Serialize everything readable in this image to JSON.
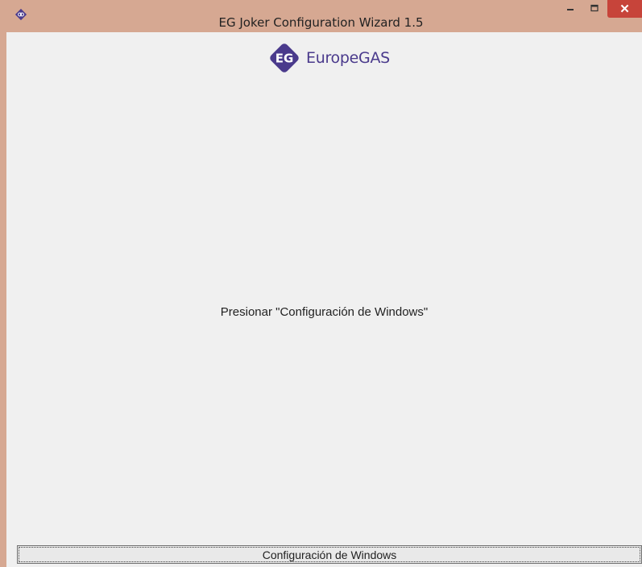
{
  "window": {
    "title": "EG Joker Configuration Wizard  1.5",
    "app_icon": "europegas-diamond-icon",
    "controls": {
      "minimize_icon": "minimize-icon",
      "maximize_icon": "maximize-icon",
      "close_label": "✕"
    }
  },
  "header": {
    "logo_mark": "EG",
    "logo_text": "EuropeGAS"
  },
  "main": {
    "instruction": "Presionar \"Configuración de Windows\""
  },
  "footer": {
    "button_label": "Configuración de Windows"
  },
  "colors": {
    "titlebar": "#d6a892",
    "close_button": "#c7443a",
    "brand": "#4a3a8c",
    "client_bg": "#f0f0f0"
  }
}
